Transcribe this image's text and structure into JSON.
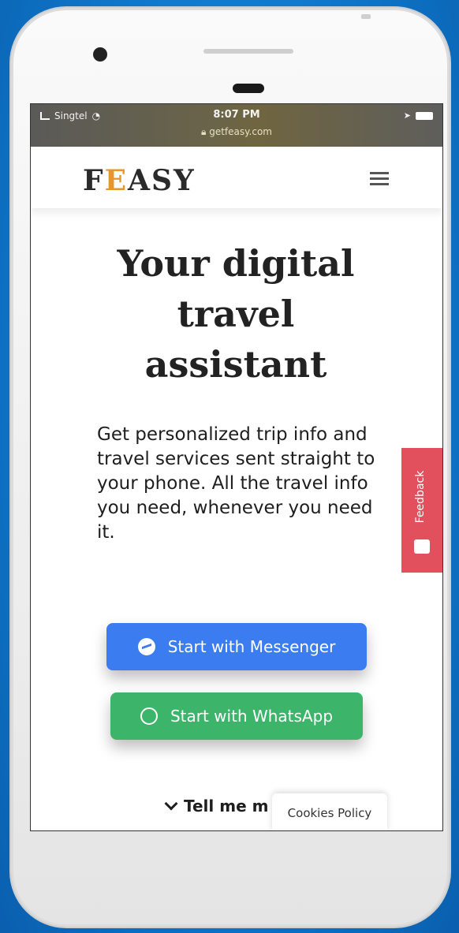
{
  "statusbar": {
    "carrier": "Singtel",
    "time": "8:07 PM",
    "url": "getfeasy.com"
  },
  "navbar": {
    "logo_prefix": "F",
    "logo_accent": "E",
    "logo_suffix": "ASY",
    "menu_icon": "hamburger-icon"
  },
  "hero": {
    "title": "Your digital travel assistant",
    "subtitle": "Get personalized trip info and travel services sent straight to your phone. All the travel info you need, whenever you need it."
  },
  "buttons": {
    "messenger_label": "Start with Messenger",
    "whatsapp_label": "Start with WhatsApp"
  },
  "feedback": {
    "label": "Feedback"
  },
  "footer": {
    "tell_me_label": "Tell me m",
    "cookies_label": "Cookies Policy"
  },
  "colors": {
    "accent": "#e8962a",
    "messenger": "#3b7df0",
    "whatsapp": "#3cb56b",
    "feedback": "#e24f5d"
  }
}
